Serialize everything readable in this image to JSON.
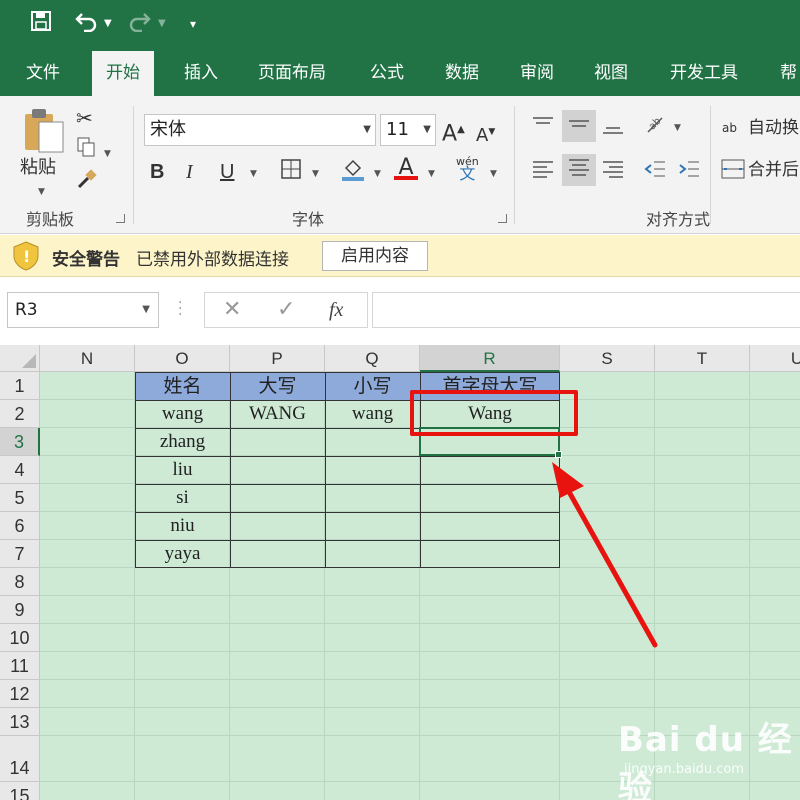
{
  "ribbon": {
    "tabs": [
      "文件",
      "开始",
      "插入",
      "页面布局",
      "公式",
      "数据",
      "审阅",
      "视图",
      "开发工具",
      "帮"
    ],
    "active_tab": "开始",
    "clipboard": {
      "paste_label": "粘贴",
      "group_label": "剪贴板"
    },
    "font": {
      "name": "宋体",
      "size": "11",
      "group_label": "字体",
      "bold": "B",
      "italic": "I",
      "underline": "U",
      "phonetic_top": "wén",
      "phonetic_bottom": "文"
    },
    "alignment": {
      "group_label": "对齐方式",
      "wrap_text": "自动换",
      "merge_center": "合并后"
    }
  },
  "security_bar": {
    "title": "安全警告",
    "message": "已禁用外部数据连接",
    "button": "启用内容"
  },
  "formula_bar": {
    "name_box": "R3",
    "fx": "fx",
    "formula": ""
  },
  "sheet": {
    "columns": [
      "N",
      "O",
      "P",
      "Q",
      "R",
      "S",
      "T",
      "U"
    ],
    "rows": [
      "1",
      "2",
      "3",
      "4",
      "5",
      "6",
      "7",
      "8",
      "9",
      "10",
      "11",
      "12",
      "13",
      "14",
      "15"
    ],
    "selected_column": "R",
    "selected_row": "3",
    "table": {
      "headers": [
        "姓名",
        "大写",
        "小写",
        "首字母大写"
      ],
      "rows": [
        [
          "wang",
          "WANG",
          "wang",
          "Wang"
        ],
        [
          "zhang",
          "",
          "",
          ""
        ],
        [
          "liu",
          "",
          "",
          ""
        ],
        [
          "si",
          "",
          "",
          ""
        ],
        [
          "niu",
          "",
          "",
          ""
        ],
        [
          "yaya",
          "",
          "",
          ""
        ]
      ]
    }
  },
  "watermark": {
    "main": "Bai du 经验",
    "sub": "jingyan.baidu.com"
  },
  "colors": {
    "excel_green": "#217346",
    "header_fill": "#8eaadb",
    "sheet_bg": "#ceead5",
    "annotation_red": "#e8130e"
  }
}
